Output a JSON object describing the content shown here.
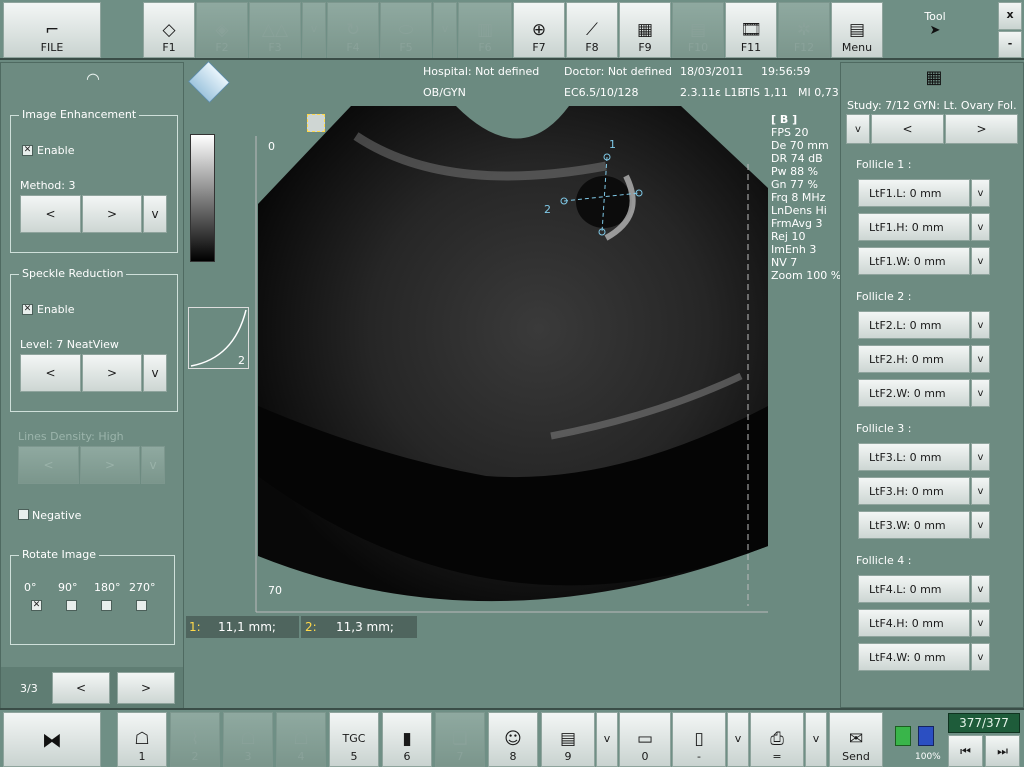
{
  "topbar": {
    "file_label": "FILE",
    "f1": "F1",
    "f2": "F2",
    "f3": "F3",
    "f4": "F4",
    "f5": "F5",
    "f6": "F6",
    "f7": "F7",
    "f8": "F8",
    "f9": "F9",
    "f10": "F10",
    "f11": "F11",
    "f12": "F12",
    "v": "v",
    "menu": "Menu",
    "tool": "Tool",
    "close": "x",
    "minimize": "-"
  },
  "header": {
    "hospital": "Hospital: Not defined",
    "doctor": "Doctor: Not defined",
    "date": "18/03/2011",
    "time": "19:56:59",
    "exam": "OB/GYN",
    "probe": "EC6.5/10/128",
    "version": "2.3.11ɛ L1B",
    "tis": "TIS 1,11",
    "mi": "MI 0,73"
  },
  "left": {
    "image_enh_title": "Image Enhancement",
    "enable": "Enable",
    "method": "Method: 3",
    "speckle_title": "Speckle Reduction",
    "level": "Level: 7 NeatView",
    "lines_density": "Lines Density: High",
    "negative": "Negative",
    "rotate_title": "Rotate Image",
    "angles": [
      "0°",
      "90°",
      "180°",
      "270°"
    ],
    "prev": "<",
    "next": ">",
    "v": "v",
    "page": "3/3"
  },
  "image": {
    "depth_top": "0",
    "depth_bottom": "70",
    "curve_num": "2",
    "mode": "[ B ]",
    "params": [
      "FPS  20",
      "De  70 mm",
      "DR  74 dB",
      "Pw  88 %",
      "Gn  77 %",
      "Frq  8 MHz",
      "LnDens  Hi",
      "FrmAvg  3",
      "Rej  10",
      "ImEnh  3",
      "NV  7",
      "Zoom  100 %"
    ],
    "m1": "1:",
    "m1_val": "11,1 mm;",
    "m2": "2:",
    "m2_val": "11,3 mm;",
    "cal1": "1",
    "cal2": "2"
  },
  "right": {
    "study": "Study:  7/12 GYN: Lt. Ovary Fol.",
    "v": "v",
    "prev": "<",
    "next": ">",
    "follicles": [
      {
        "title": "Follicle 1 :",
        "l": "LtF1.L: 0 mm",
        "h": "LtF1.H: 0 mm",
        "w": "LtF1.W: 0 mm"
      },
      {
        "title": "Follicle 2 :",
        "l": "LtF2.L: 0 mm",
        "h": "LtF2.H: 0 mm",
        "w": "LtF2.W: 0 mm"
      },
      {
        "title": "Follicle 3 :",
        "l": "LtF3.L: 0 mm",
        "h": "LtF3.H: 0 mm",
        "w": "LtF3.W: 0 mm"
      },
      {
        "title": "Follicle 4 :",
        "l": "LtF4.L: 0 mm",
        "h": "LtF4.H: 0 mm",
        "w": "LtF4.W: 0 mm"
      }
    ]
  },
  "bottom": {
    "b1": "1",
    "b2": "2",
    "b3": "3",
    "b4": "4",
    "tgc": "TGC",
    "b5": "5",
    "b6": "6",
    "b7": "7",
    "b8": "8",
    "b9": "9",
    "b0": "0",
    "dash": "-",
    "eq": "=",
    "v": "v",
    "send": "Send",
    "counter": "377/377",
    "battery": "100%"
  }
}
